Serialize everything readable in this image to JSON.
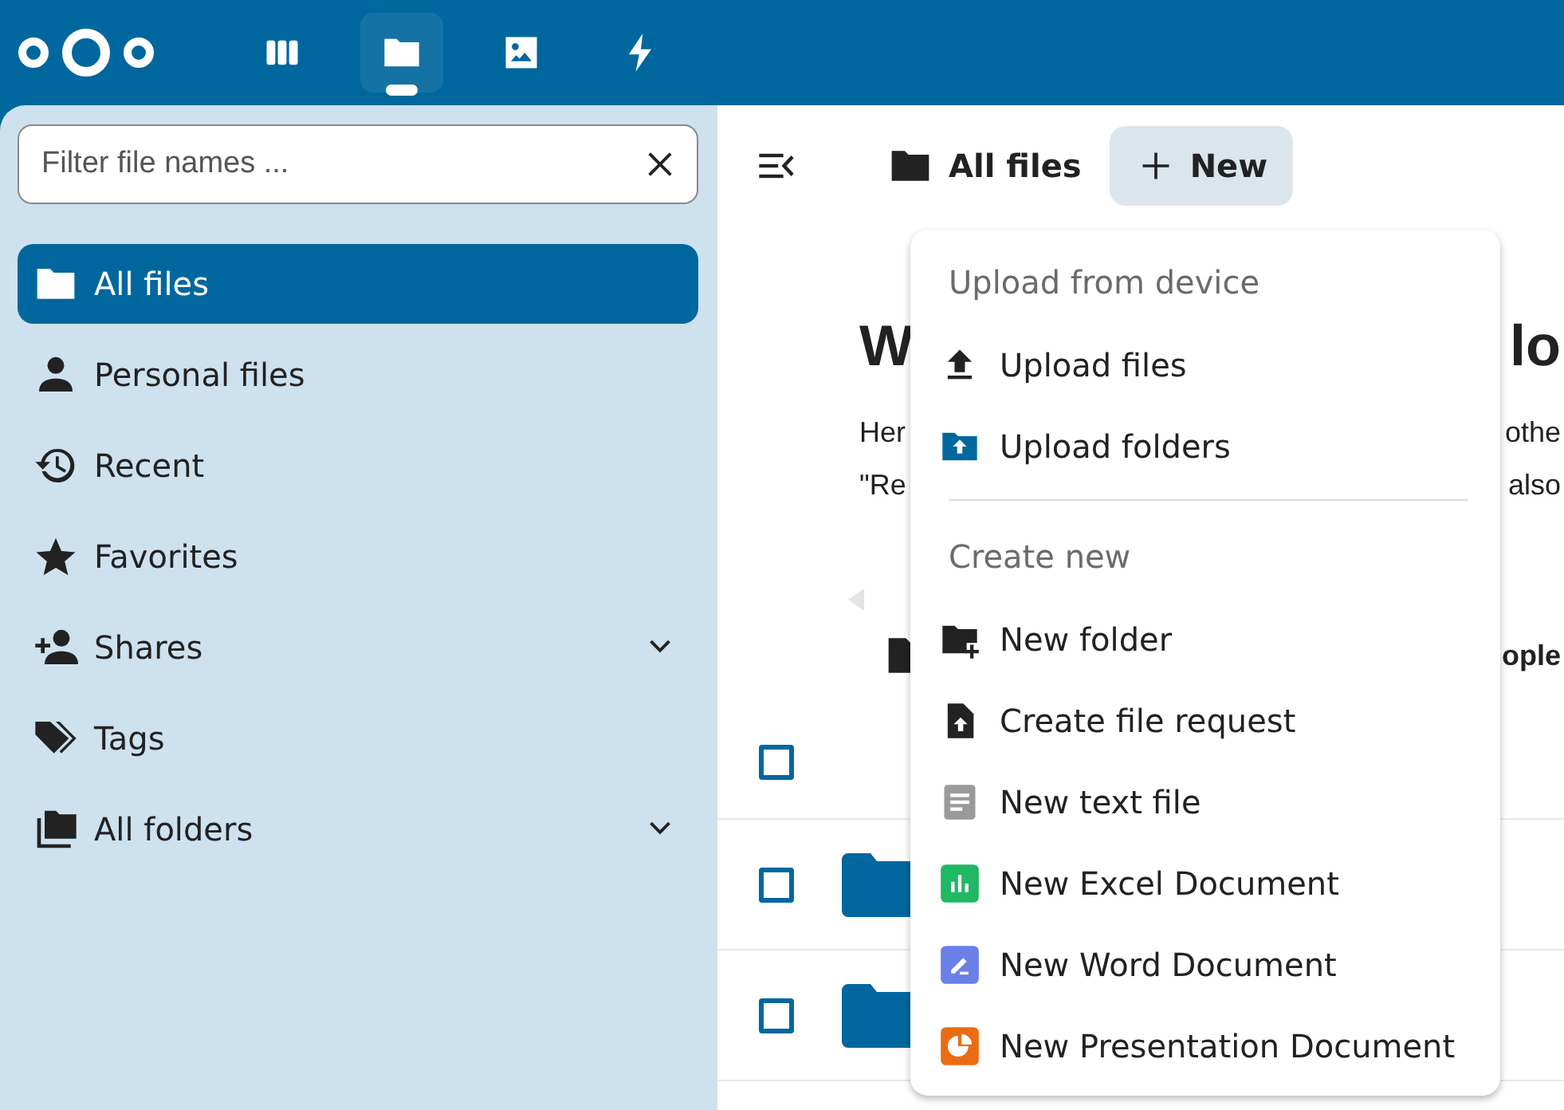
{
  "header": {
    "apps": [
      {
        "kind": "dashboard",
        "selected": false
      },
      {
        "kind": "files",
        "selected": true
      },
      {
        "kind": "photos",
        "selected": false
      },
      {
        "kind": "activity",
        "selected": false
      }
    ]
  },
  "sidebar": {
    "filter": {
      "placeholder": "Filter file names ..."
    },
    "items": [
      {
        "label": "All files",
        "kind": "folder",
        "selected": true,
        "has_children": false
      },
      {
        "label": "Personal files",
        "kind": "person",
        "selected": false,
        "has_children": false
      },
      {
        "label": "Recent",
        "kind": "history",
        "selected": false,
        "has_children": false
      },
      {
        "label": "Favorites",
        "kind": "star",
        "selected": false,
        "has_children": false
      },
      {
        "label": "Shares",
        "kind": "share",
        "selected": false,
        "has_children": true
      },
      {
        "label": "Tags",
        "kind": "tag",
        "selected": false,
        "has_children": false
      },
      {
        "label": "All folders",
        "kind": "folders",
        "selected": false,
        "has_children": true
      }
    ]
  },
  "breadcrumb": {
    "label": "All files"
  },
  "new_button": {
    "label": "New"
  },
  "background": {
    "heading": [
      "W",
      "lo"
    ],
    "paragraph": [
      [
        "Her",
        "othe"
      ],
      [
        "\"Re",
        "also"
      ]
    ],
    "column_header": "ople",
    "rows": [
      {
        "kind": "header",
        "checked": false
      },
      {
        "kind": "folder",
        "checked": false
      },
      {
        "kind": "folder",
        "checked": false
      }
    ]
  },
  "new_menu": {
    "sections": [
      {
        "title": "Upload from device",
        "items": [
          {
            "label": "Upload files",
            "kind": "upload"
          },
          {
            "label": "Upload folders",
            "kind": "upload_folder"
          }
        ]
      },
      {
        "title": "Create new",
        "items": [
          {
            "label": "New folder",
            "kind": "new_folder"
          },
          {
            "label": "Create file request",
            "kind": "request"
          },
          {
            "label": "New text file",
            "kind": "text"
          },
          {
            "label": "New Excel Document",
            "kind": "sheet"
          },
          {
            "label": "New Word Document",
            "kind": "doc"
          },
          {
            "label": "New Presentation Document",
            "kind": "slides"
          }
        ]
      }
    ]
  }
}
